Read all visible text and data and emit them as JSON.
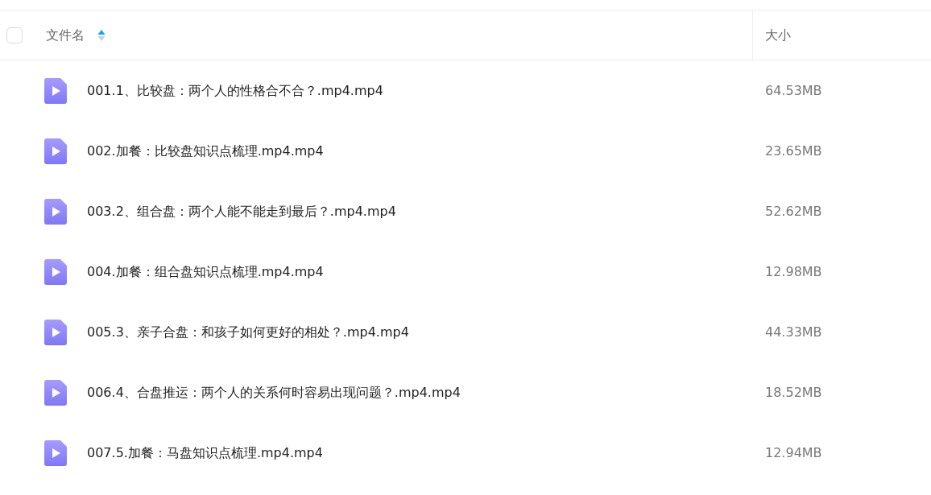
{
  "table": {
    "select_all": {
      "checked": false
    },
    "columns": [
      {
        "label": "文件名",
        "sorted_ascending": true
      },
      {
        "label": "大小"
      }
    ],
    "rows": [
      {
        "name": "001.1、比较盘：两个人的性格合不合？.mp4.mp4",
        "size": "64.53MB"
      },
      {
        "name": "002.加餐：比较盘知识点梳理.mp4.mp4",
        "size": "23.65MB"
      },
      {
        "name": "003.2、组合盘：两个人能不能走到最后？.mp4.mp4",
        "size": "52.62MB"
      },
      {
        "name": "004.加餐：组合盘知识点梳理.mp4.mp4",
        "size": "12.98MB"
      },
      {
        "name": "005.3、亲子合盘：和孩子如何更好的相处？.mp4.mp4",
        "size": "44.33MB"
      },
      {
        "name": "006.4、合盘推运：两个人的关系何时容易出现问题？.mp4.mp4",
        "size": "18.52MB"
      },
      {
        "name": "007.5.加餐：马盘知识点梳理.mp4.mp4",
        "size": "12.94MB"
      }
    ]
  }
}
